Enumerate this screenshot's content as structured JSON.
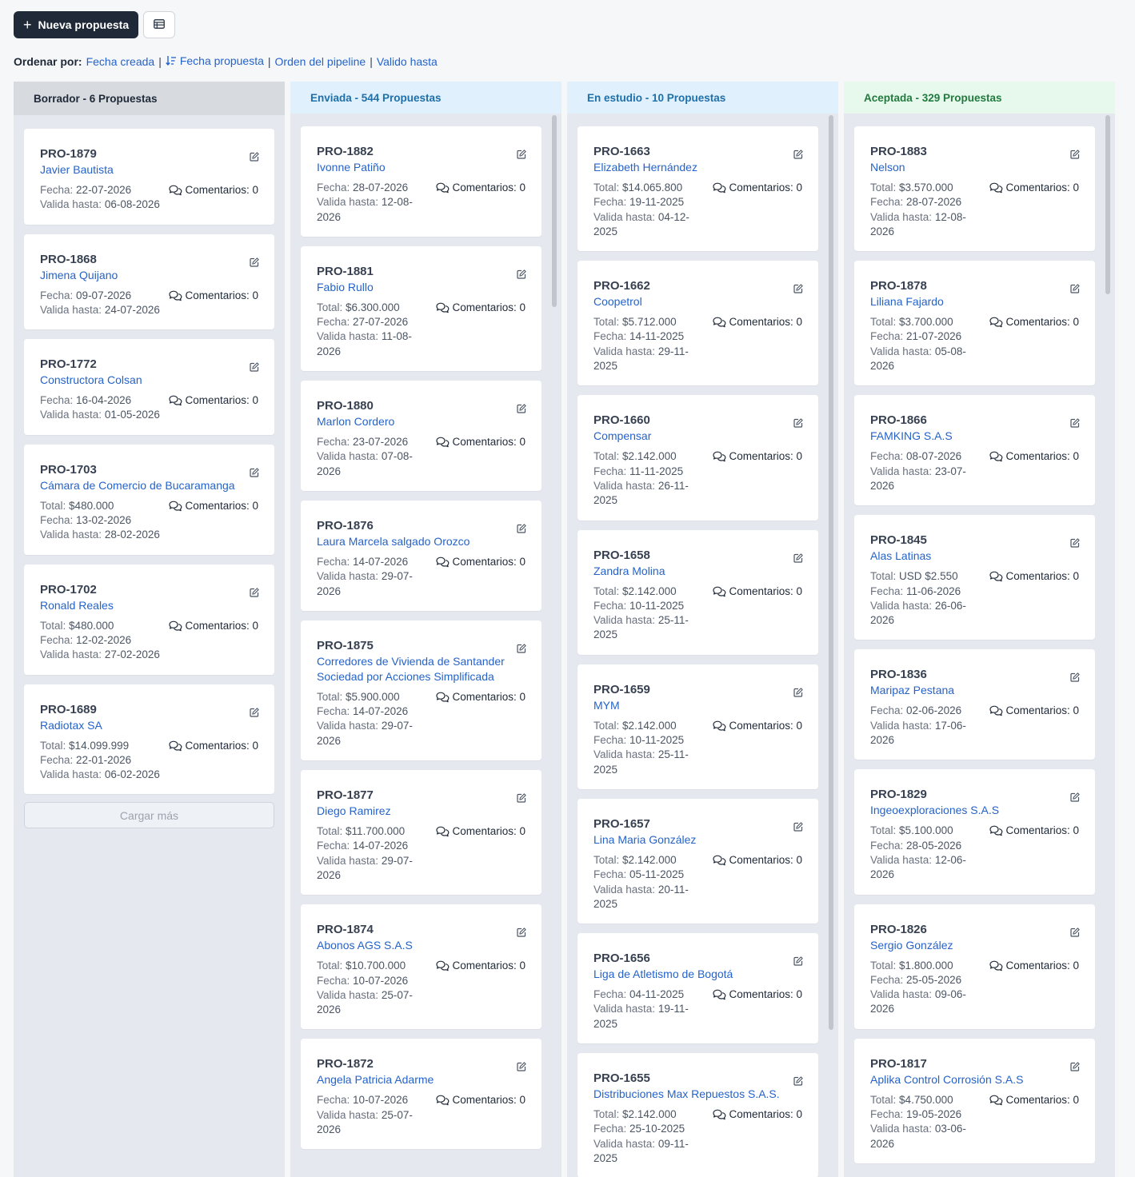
{
  "toolbar": {
    "new_label": "Nueva propuesta",
    "table_icon": "table-icon"
  },
  "sort": {
    "label": "Ordenar por:",
    "options": [
      "Fecha creada",
      "Fecha propuesta",
      "Orden del pipeline",
      "Valido hasta"
    ],
    "sep": "|"
  },
  "labels": {
    "total": "Total:",
    "fecha": "Fecha:",
    "valida": "Valida hasta:",
    "comments": "Comentarios: 0"
  },
  "columns": [
    {
      "title": "Borrador - 6 Propuestas",
      "color": "#d7dbe0",
      "cards": [
        {
          "code": "PRO-1879",
          "client": "Javier Bautista",
          "total": null,
          "fecha": "22-07-2026",
          "valida": [
            "06-08-2026"
          ]
        },
        {
          "code": "PRO-1868",
          "client": "Jimena Quijano",
          "total": null,
          "fecha": "09-07-2026",
          "valida": [
            "24-07-2026"
          ]
        },
        {
          "code": "PRO-1772",
          "client": "Constructora Colsan",
          "total": null,
          "fecha": "16-04-2026",
          "valida": [
            "01-05-2026"
          ]
        },
        {
          "code": "PRO-1703",
          "client": "Cámara de Comercio de Bucaramanga",
          "total": "$480.000",
          "fecha": "13-02-2026",
          "valida": [
            "28-02-2026"
          ]
        },
        {
          "code": "PRO-1702",
          "client": "Ronald Reales",
          "total": "$480.000",
          "fecha": "12-02-2026",
          "valida": [
            "27-02-2026"
          ]
        },
        {
          "code": "PRO-1689",
          "client": "Radiotax SA",
          "total": "$14.099.999",
          "fecha": "22-01-2026",
          "valida": [
            "06-02-2026"
          ]
        }
      ],
      "load_more": "Cargar más"
    },
    {
      "title": "Enviada - 544 Propuestas",
      "color": "#e0f0fd",
      "cards": [
        {
          "code": "PRO-1882",
          "client": "Ivonne Patiño",
          "total": null,
          "fecha": "28-07-2026",
          "valida": [
            "12-08-",
            "2026"
          ]
        },
        {
          "code": "PRO-1881",
          "client": "Fabio Rullo",
          "total": "$6.300.000",
          "fecha": "27-07-2026",
          "valida": [
            "11-08-",
            "2026"
          ]
        },
        {
          "code": "PRO-1880",
          "client": "Marlon Cordero",
          "total": null,
          "fecha": "23-07-2026",
          "valida": [
            "07-08-",
            "2026"
          ]
        },
        {
          "code": "PRO-1876",
          "client": "Laura Marcela salgado Orozco",
          "total": null,
          "fecha": "14-07-2026",
          "valida": [
            "29-07-",
            "2026"
          ]
        },
        {
          "code": "PRO-1875",
          "client": "Corredores de Vivienda de Santander Sociedad por Acciones Simplificada",
          "total": "$5.900.000",
          "fecha": "14-07-2026",
          "valida": [
            "29-07-",
            "2026"
          ]
        },
        {
          "code": "PRO-1877",
          "client": "Diego Ramirez",
          "total": "$11.700.000",
          "fecha": "14-07-2026",
          "valida": [
            "29-07-",
            "2026"
          ]
        },
        {
          "code": "PRO-1874",
          "client": "Abonos AGS S.A.S",
          "total": "$10.700.000",
          "fecha": "10-07-2026",
          "valida": [
            "25-07-",
            "2026"
          ]
        },
        {
          "code": "PRO-1872",
          "client": "Angela Patricia Adarme",
          "total": null,
          "fecha": "10-07-2026",
          "valida": [
            "25-07-",
            "2026"
          ]
        }
      ]
    },
    {
      "title": "En estudio - 10 Propuestas",
      "color": "#e0f0fd",
      "cards": [
        {
          "code": "PRO-1663",
          "client": "Elizabeth Hernández",
          "total": "$14.065.800",
          "fecha": "19-11-2025",
          "valida": [
            "04-12-",
            "2025"
          ]
        },
        {
          "code": "PRO-1662",
          "client": "Coopetrol",
          "total": "$5.712.000",
          "fecha": "14-11-2025",
          "valida": [
            "29-11-",
            "2025"
          ]
        },
        {
          "code": "PRO-1660",
          "client": "Compensar",
          "total": "$2.142.000",
          "fecha": "11-11-2025",
          "valida": [
            "26-11-",
            "2025"
          ]
        },
        {
          "code": "PRO-1658",
          "client": "Zandra Molina",
          "total": "$2.142.000",
          "fecha": "10-11-2025",
          "valida": [
            "25-11-",
            "2025"
          ]
        },
        {
          "code": "PRO-1659",
          "client": "MYM",
          "total": "$2.142.000",
          "fecha": "10-11-2025",
          "valida": [
            "25-11-",
            "2025"
          ]
        },
        {
          "code": "PRO-1657",
          "client": "Lina Maria González",
          "total": "$2.142.000",
          "fecha": "05-11-2025",
          "valida": [
            "20-11-",
            "2025"
          ]
        },
        {
          "code": "PRO-1656",
          "client": "Liga de Atletismo de Bogotá",
          "total": null,
          "fecha": "04-11-2025",
          "valida": [
            "19-11-2025"
          ]
        },
        {
          "code": "PRO-1655",
          "client": "Distribuciones Max Repuestos S.A.S.",
          "total": "$2.142.000",
          "fecha": "25-10-2025",
          "valida": [
            "09-11-",
            "2025"
          ]
        }
      ]
    },
    {
      "title": "Aceptada - 329 Propuestas",
      "color": "#e6f9ec",
      "cards": [
        {
          "code": "PRO-1883",
          "client": "Nelson",
          "total": "$3.570.000",
          "fecha": "28-07-2026",
          "valida": [
            "12-08-",
            "2026"
          ]
        },
        {
          "code": "PRO-1878",
          "client": "Liliana Fajardo",
          "total": "$3.700.000",
          "fecha": "21-07-2026",
          "valida": [
            "05-08-",
            "2026"
          ]
        },
        {
          "code": "PRO-1866",
          "client": "FAMKING S.A.S",
          "total": null,
          "fecha": "08-07-2026",
          "valida": [
            "23-07-",
            "2026"
          ]
        },
        {
          "code": "PRO-1845",
          "client": "Alas Latinas",
          "total": "USD $2.550",
          "fecha": "11-06-2026",
          "valida": [
            "26-06-",
            "2026"
          ]
        },
        {
          "code": "PRO-1836",
          "client": "Maripaz Pestana",
          "total": null,
          "fecha": "02-06-2026",
          "valida": [
            "17-06-",
            "2026"
          ]
        },
        {
          "code": "PRO-1829",
          "client": "Ingeoexploraciones S.A.S",
          "total": "$5.100.000",
          "fecha": "28-05-2026",
          "valida": [
            "12-06-",
            "2026"
          ]
        },
        {
          "code": "PRO-1826",
          "client": "Sergio González",
          "total": "$1.800.000",
          "fecha": "25-05-2026",
          "valida": [
            "09-06-",
            "2026"
          ]
        },
        {
          "code": "PRO-1817",
          "client": "Aplika Control Corrosión S.A.S",
          "total": "$4.750.000",
          "fecha": "19-05-2026",
          "valida": [
            "03-06-",
            "2026"
          ]
        }
      ]
    }
  ]
}
